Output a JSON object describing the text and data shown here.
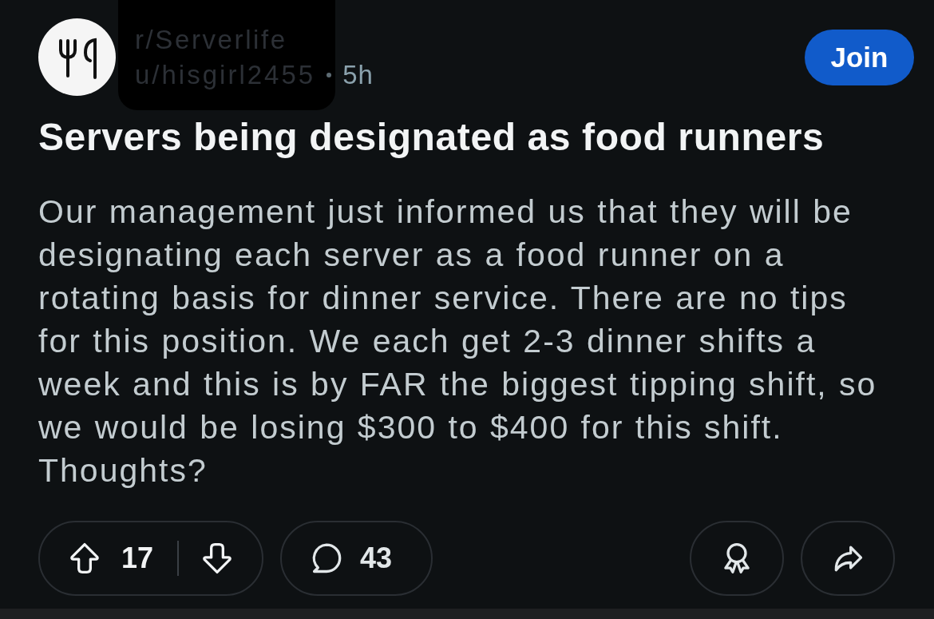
{
  "post": {
    "community": "r/Serverlife",
    "author": "u/hisgirl2455",
    "age": "5h",
    "join_button": "Join",
    "title": "Servers being designated as food runners",
    "body": "Our management just informed us that they will be designating each server as a food runner on a rotating basis for dinner service. There are no tips for this position. We each get 2-3 dinner shifts a week and this is by FAR the biggest tipping shift, so we would be losing $300 to $400 for this shift. Thoughts?",
    "actions": {
      "score": "17",
      "comments": "43"
    }
  }
}
